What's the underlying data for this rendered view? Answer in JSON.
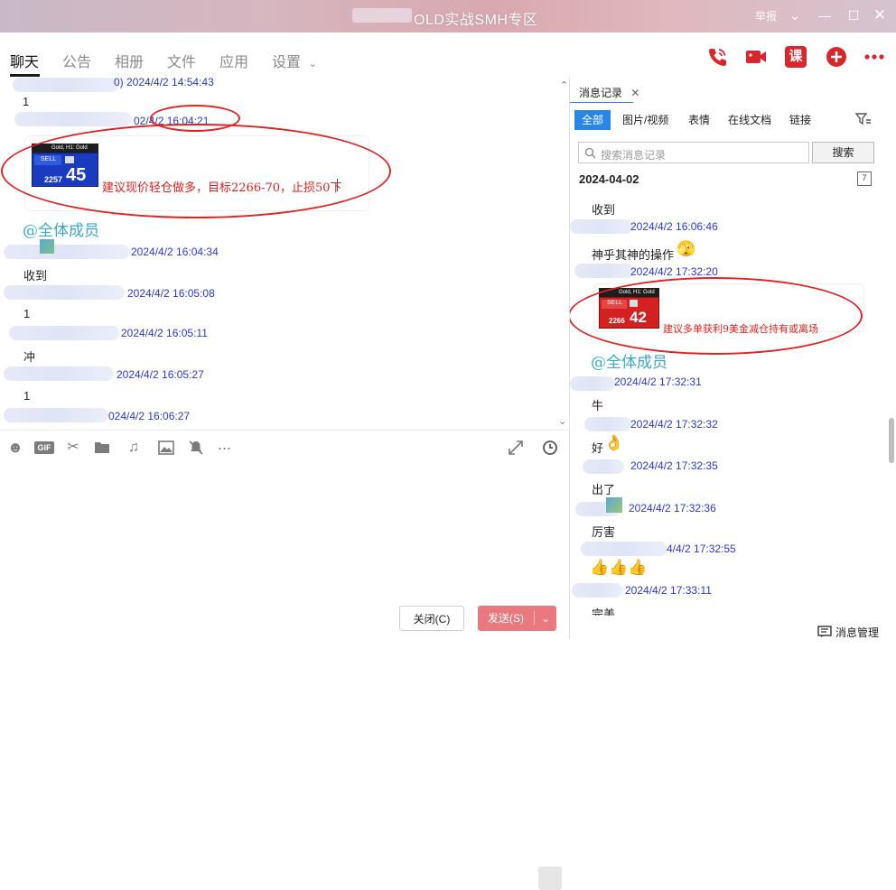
{
  "window": {
    "title": "OLD实战SMH专区",
    "report_label": "举报"
  },
  "tabs": [
    {
      "label": "聊天"
    },
    {
      "label": "公告"
    },
    {
      "label": "相册"
    },
    {
      "label": "文件"
    },
    {
      "label": "应用"
    },
    {
      "label": "设置"
    }
  ],
  "toolbar_icons": [
    "phone-icon",
    "video-icon",
    "course-icon",
    "add-icon",
    "more-icon"
  ],
  "course_label": "课",
  "chat": {
    "messages": [
      {
        "time": "0) 2024/4/2 14:54:43",
        "text": "1"
      },
      {
        "time": "02/4/2 16:04:21",
        "text": ""
      },
      {
        "time": "2024/4/2 16:04:34",
        "text": "收到"
      },
      {
        "time": "2024/4/2 16:05:08",
        "text": "1"
      },
      {
        "time": "2024/4/2 16:05:11",
        "text": "冲"
      },
      {
        "time": "2024/4/2 16:05:27",
        "text": "1"
      },
      {
        "time": "024/4/2 16:06:27",
        "text": ""
      }
    ],
    "trade_card": {
      "header": "Gold, H1: Gold",
      "side": "SELL",
      "big_digits": "45",
      "small_digits": "2257"
    },
    "annotation": "建议现价轻仓做多，目标2266-70，止损50下",
    "at_all": "@全体成员"
  },
  "input_toolbar": [
    "emoji-icon",
    "gif-icon",
    "scissors-icon",
    "folder-icon",
    "music-icon",
    "image-icon",
    "mute-bell-icon",
    "more-dots-icon",
    "expand-icon",
    "history-clock-icon"
  ],
  "gif_label": "GIF",
  "buttons": {
    "close": "关闭(C)",
    "send": "发送(S)"
  },
  "history_panel": {
    "tab_title": "消息记录",
    "filters": [
      "全部",
      "图片/视频",
      "表情",
      "在线文档",
      "链接"
    ],
    "search_placeholder": "搜索消息记录",
    "search_button": "搜索",
    "date_heading": "2024-04-02",
    "calendar_day": "7",
    "items": [
      {
        "text": "收到",
        "time": "2024/4/2 16:06:46"
      },
      {
        "text": "神乎其神的操作",
        "time": "2024/4/2 17:32:20"
      },
      {
        "text": "",
        "time": "2024/4/2 17:32:31"
      },
      {
        "text": "牛",
        "time": "2024/4/2 17:32:32"
      },
      {
        "text": "好",
        "time": "2024/4/2 17:32:35"
      },
      {
        "text": "出了",
        "time": "2024/4/2 17:32:36"
      },
      {
        "text": "厉害",
        "time": "4/4/2 17:32:55"
      },
      {
        "text": "👍👍👍",
        "time": "2024/4/2 17:33:11"
      },
      {
        "text": "完美",
        "time": ""
      }
    ],
    "trade_card": {
      "header": "Gold, H1: Gold",
      "side": "SELL",
      "big_digits": "42",
      "small_digits": "2266"
    },
    "annotation": "建议多单获利9美金减仓持有或离场",
    "at_all": "@全体成员",
    "footer": "消息管理"
  },
  "colors": {
    "accent_blue": "#2a86e5",
    "time_blue": "#2b36d9",
    "annotation_red": "#e02020",
    "send_pink": "#e9787f",
    "icon_red": "#d9262c"
  }
}
